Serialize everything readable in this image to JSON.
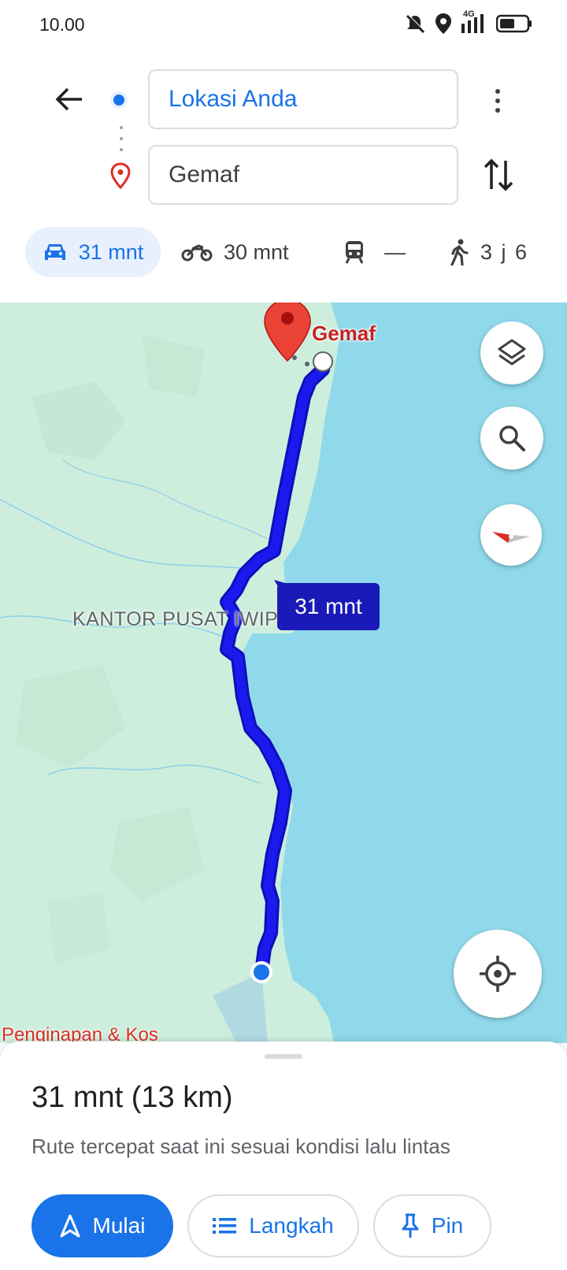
{
  "status_bar": {
    "time": "10.00",
    "network": "4G",
    "icons": [
      "mute-icon",
      "location-icon",
      "signal-icon",
      "battery-icon"
    ]
  },
  "directions": {
    "origin": "Lokasi Anda",
    "destination": "Gemaf"
  },
  "modes": [
    {
      "name": "car",
      "icon": "car-icon",
      "label": "31 mnt",
      "active": true
    },
    {
      "name": "motorcycle",
      "icon": "motorcycle-icon",
      "label": "30 mnt"
    },
    {
      "name": "transit",
      "icon": "train-icon",
      "label": "—"
    },
    {
      "name": "walk",
      "icon": "walk-icon",
      "label": "3 j 6"
    }
  ],
  "map": {
    "destination_label": "Gemaf",
    "area_label": "KANTOR PUSAT IWIP",
    "poi_label": "Penginapan & Kos",
    "eta_bubble": "31 mnt"
  },
  "sheet": {
    "summary": "31 mnt (13 km)",
    "description": "Rute tercepat saat ini sesuai kondisi lalu lintas",
    "buttons": {
      "start": "Mulai",
      "steps": "Langkah",
      "pin": "Pin"
    }
  },
  "colors": {
    "accent": "#1a73e8",
    "route": "#1a1aee",
    "land": "#cdeedd",
    "water": "#8fd9ea",
    "pin": "#ea4335"
  }
}
